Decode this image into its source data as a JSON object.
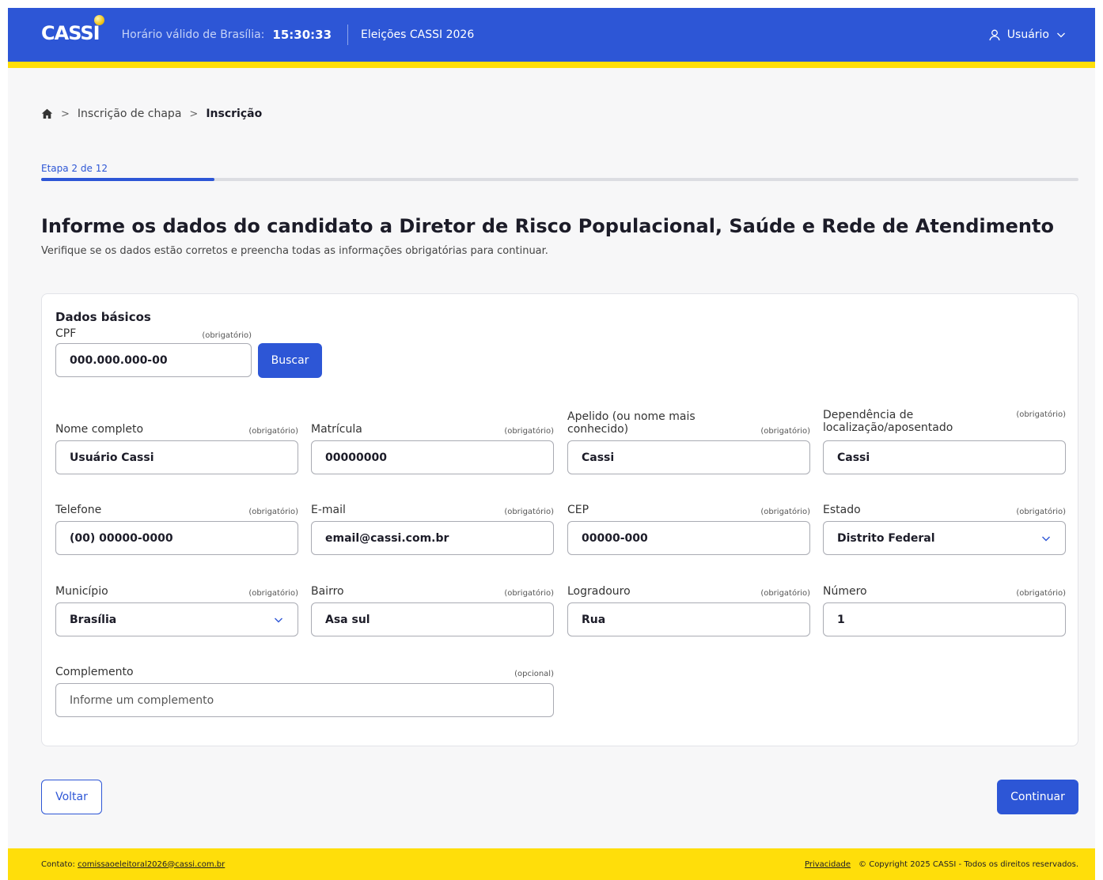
{
  "header": {
    "logo": "CASSI",
    "time_label": "Horário válido de Brasília:",
    "time_value": "15:30:33",
    "title": "Eleições CASSI 2026",
    "user_label": "Usuário"
  },
  "breadcrumb": {
    "items": [
      "Inscrição de chapa",
      "Inscrição"
    ]
  },
  "progress": {
    "label": "Etapa 2 de 12",
    "current": 2,
    "total": 12,
    "fraction": 0.1667
  },
  "page": {
    "title": "Informe os dados do candidato a Diretor de Risco Populacional, Saúde e Rede de Atendimento",
    "subtitle": "Verifique se os dados estão corretos e preencha todas as informações obrigatórias para continuar."
  },
  "form": {
    "section_title": "Dados básicos",
    "required_tag": "(obrigatório)",
    "optional_tag": "(opcional)",
    "cpf": {
      "label": "CPF",
      "value": "000.000.000-00"
    },
    "search_button": "Buscar",
    "nome": {
      "label": "Nome completo",
      "value": "Usuário Cassi"
    },
    "matricula": {
      "label": "Matrícula",
      "value": "00000000"
    },
    "apelido": {
      "label": "Apelido (ou nome mais conhecido)",
      "value": "Cassi"
    },
    "dependencia": {
      "label": "Dependência de localização/aposentado",
      "value": "Cassi"
    },
    "telefone": {
      "label": "Telefone",
      "value": "(00) 00000-0000"
    },
    "email": {
      "label": "E-mail",
      "value": "email@cassi.com.br"
    },
    "cep": {
      "label": "CEP",
      "value": "00000-000"
    },
    "estado": {
      "label": "Estado",
      "value": "Distrito Federal"
    },
    "municipio": {
      "label": "Município",
      "value": "Brasília"
    },
    "bairro": {
      "label": "Bairro",
      "value": "Asa sul"
    },
    "logradouro": {
      "label": "Logradouro",
      "value": "Rua"
    },
    "numero": {
      "label": "Número",
      "value": "1"
    },
    "complemento": {
      "label": "Complemento",
      "value": "",
      "placeholder": "Informe um complemento"
    }
  },
  "actions": {
    "back": "Voltar",
    "continue": "Continuar"
  },
  "footer": {
    "contact_label": "Contato:",
    "contact_email": "comissaoeleitoral2026@cassi.com.br",
    "privacy": "Privacidade",
    "copyright": "© Copyright 2025 CASSI - Todos os direitos reservados."
  },
  "colors": {
    "primary": "#2d56d6",
    "accent_yellow": "#ffde0a"
  },
  "icons": [
    "home-icon",
    "chevron-right-icon",
    "user-icon",
    "chevron-down-icon"
  ]
}
